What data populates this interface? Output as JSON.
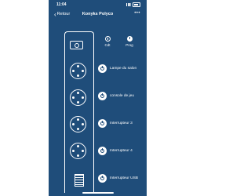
{
  "status_bar": {
    "time": "11:04"
  },
  "nav": {
    "back_label": "Retour",
    "title": "Konyks Polyco",
    "more_label": "•••"
  },
  "top_actions": [
    {
      "label": "Cdt",
      "icon": "alarm-icon"
    },
    {
      "label": "Prog",
      "icon": "program-icon"
    }
  ],
  "outlets": [
    {
      "label": "Lampe du salon",
      "icon": "power-icon"
    },
    {
      "label": "console de jeu",
      "icon": "power-icon"
    },
    {
      "label": "Interrupteur 3",
      "icon": "power-icon"
    },
    {
      "label": "Interrupteur 4",
      "icon": "power-icon"
    },
    {
      "label": "Interrupteur USB",
      "icon": "power-icon"
    }
  ],
  "colors": {
    "background": "#1f4d7a",
    "foreground": "#ffffff"
  }
}
